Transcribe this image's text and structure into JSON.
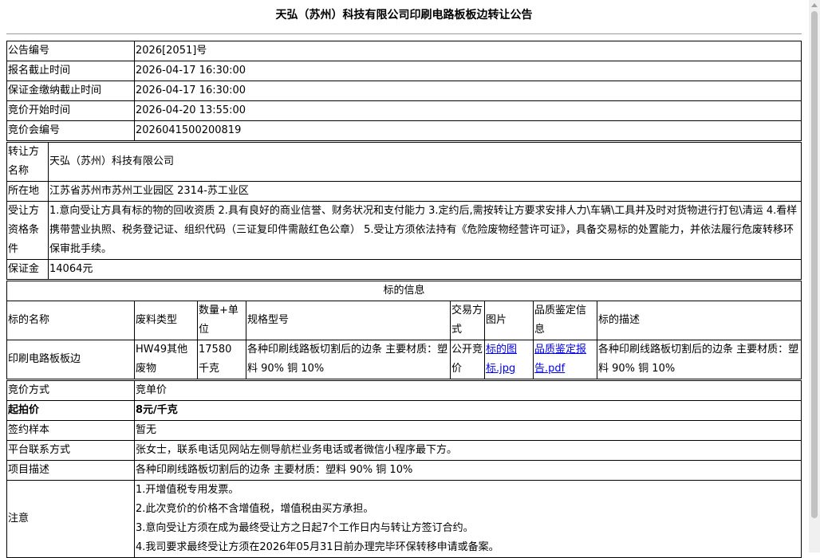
{
  "title": "天弘（苏州）科技有限公司印刷电路板板边转让公告",
  "basic": [
    {
      "label": "公告编号",
      "value": "2026[2051]号"
    },
    {
      "label": "报名截止时间",
      "value": "2026-04-17 16:30:00"
    },
    {
      "label": "保证金缴纳截止时间",
      "value": "2026-04-17 16:30:00"
    },
    {
      "label": "竞价开始时间",
      "value": "2026-04-20 13:55:00"
    },
    {
      "label": "竞价会编号",
      "value": "2026041500200819"
    }
  ],
  "seller": {
    "name_label": "转让方名称",
    "name_value": "天弘（苏州）科技有限公司",
    "location_label": "所在地",
    "location_value": "江苏省苏州市苏州工业园区 2314-苏工业区",
    "qual_label": "受让方资格条件",
    "qual_value": "1.意向受让方具有标的物的回收资质 2.具有良好的商业信誉、财务状况和支付能力 3.定约后,需按转让方要求安排人力\\车辆\\工具并及时对货物进行打包\\清运 4.看样携带营业执照、税务登记证、组织代码（三证复印件需敲红色公章） 5.受让方须依法持有《危险废物经营许可证》，具备交易标的处置能力，并依法履行危废转移环保审批手续。",
    "deposit_label": "保证金",
    "deposit_value": "14064元"
  },
  "items": {
    "section_title": "标的信息",
    "headers": [
      "标的名称",
      "废料类型",
      "数量+单位",
      "规格型号",
      "交易方式",
      "图片",
      "品质鉴定信息",
      "标的描述"
    ],
    "row": {
      "name": "印刷电路板板边",
      "type": "HW49其他废物",
      "qty": "17580 千克",
      "spec": "各种印刷线路板切割后的边条 主要材质：塑料 90% 铜 10%",
      "mode": "公开竞价",
      "image_link": "标的图标.jpg",
      "quality_link": "品质鉴定报告.pdf",
      "desc": "各种印刷线路板切割后的边条 主要材质：塑料 90% 铜 10%"
    }
  },
  "bidding": [
    {
      "label": "竞价方式",
      "value": "竞单价",
      "bold": false
    },
    {
      "label": "起拍价",
      "value": "8元/千克",
      "bold": true
    },
    {
      "label": "签约样本",
      "value": "暂无",
      "bold": false
    },
    {
      "label": "平台联系方式",
      "value": "张女士，联系电话见网站左侧导航栏业务电话或者微信小程序最下方。",
      "bold": false
    },
    {
      "label": "项目描述",
      "value": "各种印刷线路板切割后的边条 主要材质：塑料 90% 铜 10%",
      "bold": false
    }
  ],
  "notice": {
    "label": "注意",
    "lines": [
      "1.开增值税专用发票。",
      "2.此次竞价的价格不含增值税，增值税由买方承担。",
      "3.意向受让方须在成为最终受让方之日起7个工作日内与转让方签订合约。",
      "4.我司要求最终受让方须在2026年05月31日前办理完毕环保转移申请或备案。"
    ]
  }
}
